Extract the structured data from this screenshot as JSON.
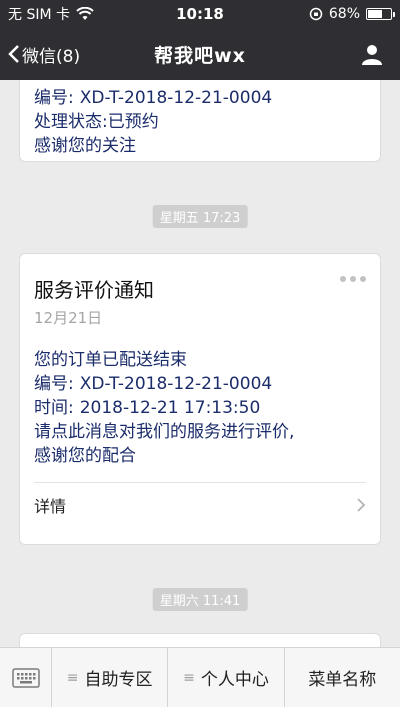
{
  "status": {
    "carrier": "无 SIM 卡",
    "time": "10:18",
    "battery_percent": "68%",
    "battery_level": 0.68
  },
  "nav": {
    "back_label": "微信(8)",
    "title": "帮我吧wx"
  },
  "messages": {
    "card1": {
      "order_label": "编号:",
      "order_value": "XD-T-2018-12-21-0004",
      "status_label": "处理状态:",
      "status_value": "已预约",
      "thanks": "感谢您的关注"
    },
    "time1": "星期五 17:23",
    "card2": {
      "title": "服务评价通知",
      "date": "12月21日",
      "line1": "您的订单已配送结束",
      "order_label": "编号:",
      "order_value": "XD-T-2018-12-21-0004",
      "time_label": "时间:",
      "time_value": "2018-12-21 17:13:50",
      "line4": "请点此消息对我们的服务进行评价,",
      "line5": "感谢您的配合",
      "details": "详情"
    },
    "time2": "星期六 11:41"
  },
  "bottom_menu": {
    "items": [
      "自助专区",
      "个人中心",
      "菜单名称"
    ]
  },
  "colors": {
    "header": "#2f2f33",
    "text_blue": "#1b2c6b",
    "background": "#ebebeb"
  }
}
